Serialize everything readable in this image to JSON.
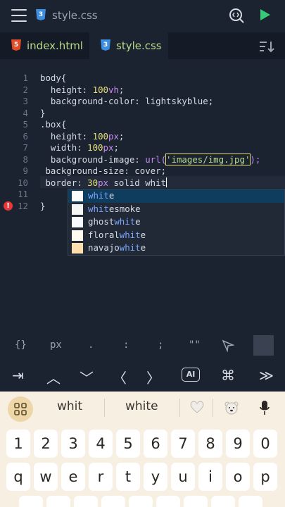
{
  "header": {
    "title": "style.css",
    "menu_icon": "hamburger-icon",
    "search_icon": "search-code-icon",
    "run_icon": "play-icon"
  },
  "tabs": [
    {
      "label": "index.html",
      "icon": "html5-icon",
      "active": false
    },
    {
      "label": "style.css",
      "icon": "css3-icon",
      "active": true
    }
  ],
  "editor": {
    "line_numbers": [
      "1",
      "2",
      "3",
      "4",
      "5",
      "6",
      "7",
      "8",
      "9",
      "10",
      "11",
      "12"
    ],
    "error_marker": "!"
  },
  "code": {
    "l1_sel": "body{",
    "l2_prop": "  height: ",
    "l2_num": "100",
    "l2_unit": "vh",
    "l2_end": ";",
    "l3_prop": "  background-color: ",
    "l3_val": "lightskyblue",
    "l3_end": ";",
    "l4": "}",
    "l5_sel": ".box{",
    "l6_prop": "  height: ",
    "l6_num": "100",
    "l6_unit": "px",
    "l6_end": ";",
    "l7_prop": "  width: ",
    "l7_num": "100",
    "l7_unit": "px",
    "l7_end": ";",
    "l8_prop": "  background-image: ",
    "l8_fn": "url(",
    "l8_str": "'images/img.jpg'",
    "l8_end": ");",
    "l9_prop": " background-size: ",
    "l9_val": "cover",
    "l9_end": ";",
    "l10_prop": " border: ",
    "l10_num": "30",
    "l10_unit": "px",
    "l10_val": " solid whit",
    "l11": "",
    "l12": "}"
  },
  "autocomplete": [
    {
      "match": "whit",
      "rest": "e",
      "prefix": "",
      "color": "#ffffff",
      "selected": true
    },
    {
      "match": "whit",
      "rest": "esmoke",
      "prefix": "",
      "color": "#f5f5f5",
      "selected": false
    },
    {
      "match": "whit",
      "rest": "e",
      "prefix": "ghost",
      "color": "#f8f8ff",
      "selected": false
    },
    {
      "match": "whit",
      "rest": "e",
      "prefix": "floral",
      "color": "#fffaf0",
      "selected": false
    },
    {
      "match": "whit",
      "rest": "e",
      "prefix": "navajo",
      "color": "#ffdead",
      "selected": false
    }
  ],
  "symbols": [
    "{}",
    "px",
    ".",
    ":",
    ";",
    "\"\""
  ],
  "navigation": {
    "tab_right": "⇥",
    "up": "︿",
    "down": "﹀",
    "left": "〈",
    "right": "〉",
    "ai": "AI",
    "cmd": "⌘",
    "fast_forward": "≫"
  },
  "keyboard": {
    "suggestions": [
      "whit",
      "white"
    ],
    "number_row": [
      "1",
      "2",
      "3",
      "4",
      "5",
      "6",
      "7",
      "8",
      "9",
      "0"
    ],
    "letter_row": [
      "q",
      "w",
      "e",
      "r",
      "t",
      "y",
      "u",
      "i",
      "o",
      "p"
    ]
  }
}
